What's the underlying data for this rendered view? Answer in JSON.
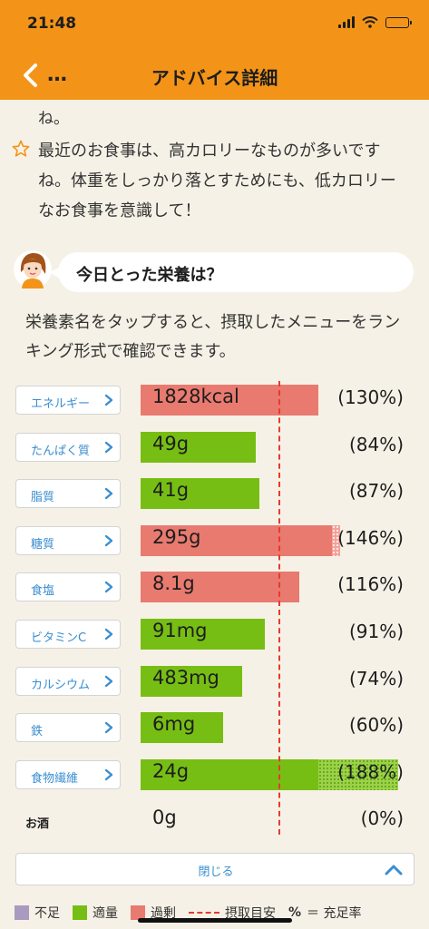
{
  "status": {
    "time": "21:48"
  },
  "header": {
    "title": "アドバイス詳細",
    "back_icon": "chevron-left-icon",
    "more_label": "…"
  },
  "advice": {
    "continued": "ね。",
    "text": "最近のお食事は、高カロリーなものが多いですね。体重をしっかり落とすためにも、低カロリーなお食事を意識して！"
  },
  "section": {
    "bubble_title": "今日とった栄養は？",
    "description": "栄養素名をタップすると、摂取したメニューをランキング形式で確認できます。"
  },
  "nutrients": [
    {
      "name": "エネルギー",
      "amount": "1828kcal",
      "percent_label": "(130%)",
      "percent": 130,
      "status": "over",
      "tappable": true
    },
    {
      "name": "たんぱく質",
      "amount": "49g",
      "percent_label": "(84%)",
      "percent": 84,
      "status": "ok",
      "tappable": true
    },
    {
      "name": "脂質",
      "amount": "41g",
      "percent_label": "(87%)",
      "percent": 87,
      "status": "ok",
      "tappable": true
    },
    {
      "name": "糖質",
      "amount": "295g",
      "percent_label": "(146%)",
      "percent": 146,
      "status": "over",
      "tappable": true
    },
    {
      "name": "食塩",
      "amount": "8.1g",
      "percent_label": "(116%)",
      "percent": 116,
      "status": "over",
      "tappable": true
    },
    {
      "name": "ビタミンC",
      "amount": "91mg",
      "percent_label": "(91%)",
      "percent": 91,
      "status": "ok",
      "tappable": true
    },
    {
      "name": "カルシウム",
      "amount": "483mg",
      "percent_label": "(74%)",
      "percent": 74,
      "status": "ok",
      "tappable": true
    },
    {
      "name": "鉄",
      "amount": "6mg",
      "percent_label": "(60%)",
      "percent": 60,
      "status": "ok",
      "tappable": true
    },
    {
      "name": "食物繊維",
      "amount": "24g",
      "percent_label": "(188%)",
      "percent": 188,
      "status": "ok",
      "tappable": true
    },
    {
      "name": "お酒",
      "amount": "0g",
      "percent_label": "(0%)",
      "percent": 0,
      "status": "ok",
      "tappable": false
    }
  ],
  "close": {
    "label": "閉じる",
    "icon": "chevron-up-icon"
  },
  "legend": {
    "insufficient": "不足",
    "adequate": "適量",
    "excess": "過剰",
    "target": "摂取目安",
    "percent_symbol": "%",
    "percent_meaning": "＝ 充足率"
  },
  "colors": {
    "header": "#f39419",
    "insufficient": "#a89bbf",
    "adequate": "#77be14",
    "excess": "#e97a70",
    "target_line": "#e53a2f",
    "link": "#3a8ed0"
  }
}
